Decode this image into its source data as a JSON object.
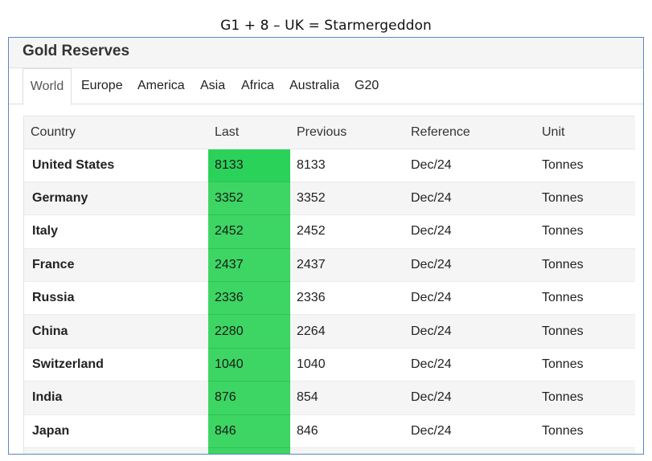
{
  "caption": "G1 + 8 – UK = Starmergeddon",
  "panel": {
    "title": "Gold Reserves"
  },
  "tabs": [
    "World",
    "Europe",
    "America",
    "Asia",
    "Africa",
    "Australia",
    "G20"
  ],
  "table": {
    "headers": {
      "country": "Country",
      "last": "Last",
      "previous": "Previous",
      "reference": "Reference",
      "unit": "Unit"
    },
    "rows": [
      {
        "country": "United States",
        "last": "8133",
        "previous": "8133",
        "reference": "Dec/24",
        "unit": "Tonnes"
      },
      {
        "country": "Germany",
        "last": "3352",
        "previous": "3352",
        "reference": "Dec/24",
        "unit": "Tonnes"
      },
      {
        "country": "Italy",
        "last": "2452",
        "previous": "2452",
        "reference": "Dec/24",
        "unit": "Tonnes"
      },
      {
        "country": "France",
        "last": "2437",
        "previous": "2437",
        "reference": "Dec/24",
        "unit": "Tonnes"
      },
      {
        "country": "Russia",
        "last": "2336",
        "previous": "2336",
        "reference": "Dec/24",
        "unit": "Tonnes"
      },
      {
        "country": "China",
        "last": "2280",
        "previous": "2264",
        "reference": "Dec/24",
        "unit": "Tonnes"
      },
      {
        "country": "Switzerland",
        "last": "1040",
        "previous": "1040",
        "reference": "Dec/24",
        "unit": "Tonnes"
      },
      {
        "country": "India",
        "last": "876",
        "previous": "854",
        "reference": "Dec/24",
        "unit": "Tonnes"
      },
      {
        "country": "Japan",
        "last": "846",
        "previous": "846",
        "reference": "Dec/24",
        "unit": "Tonnes"
      }
    ]
  },
  "colors": {
    "highlight": "#3dd563",
    "frame_border": "#5b86c6"
  }
}
